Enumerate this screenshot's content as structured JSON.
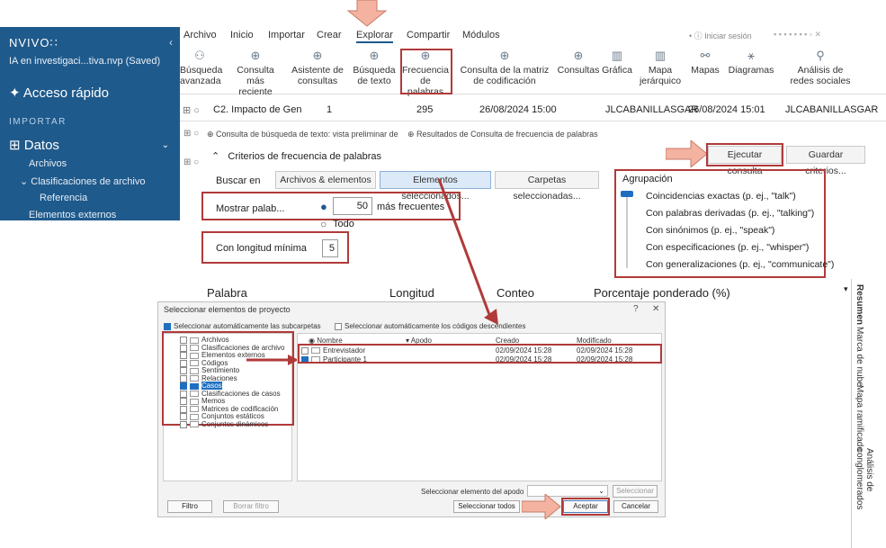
{
  "sidebar": {
    "brand": "NVIVO∷",
    "project": "IA en investigaci...tiva.nvp (Saved)",
    "quick_access": "Acceso rápido",
    "section": "IMPORTAR",
    "datos": "Datos",
    "items": [
      "Archivos",
      "Clasificaciones de archivo",
      "Referencia",
      "Elementos externos"
    ]
  },
  "menu": {
    "tabs": [
      "Archivo",
      "Inicio",
      "Importar",
      "Crear",
      "Explorar",
      "Compartir",
      "Módulos"
    ],
    "active": "Explorar",
    "right": "• ⓘ Iniciar sesión"
  },
  "ribbon": {
    "buttons": [
      {
        "l1": "Búsqueda",
        "l2": "avanzada",
        "icon": "binoculars-icon"
      },
      {
        "l1": "Consulta",
        "l2": "más reciente",
        "icon": "magnifier-icon"
      },
      {
        "l1": "Asistente de",
        "l2": "consultas",
        "icon": "magnifier-icon"
      },
      {
        "l1": "Búsqueda",
        "l2": "de texto",
        "icon": "magnifier-icon"
      },
      {
        "l1": "Frecuencia",
        "l2": "de palabras",
        "icon": "magnifier-icon"
      },
      {
        "l1": "Consulta de la matriz",
        "l2": "de codificación",
        "icon": "magnifier-icon"
      },
      {
        "l1": "Consultas",
        "l2": "",
        "icon": "magnifier-icon"
      },
      {
        "l1": "Gráfica",
        "l2": "",
        "icon": "chart-icon"
      },
      {
        "l1": "Mapa",
        "l2": "jerárquico",
        "icon": "chart-icon"
      },
      {
        "l1": "Mapas",
        "l2": "",
        "icon": "map-icon"
      },
      {
        "l1": "Diagramas",
        "l2": "",
        "icon": "diagram-icon"
      },
      {
        "l1": "Análisis de",
        "l2": "redes sociales",
        "icon": "network-icon"
      }
    ]
  },
  "row": {
    "name": "C2. Impacto de Gen",
    "count": "1",
    "refs": "295",
    "created": "26/08/2024 15:00",
    "by": "JLCABANILLASGAR",
    "modified": "26/08/2024 15:01",
    "by2": "JLCABANILLASGAR"
  },
  "panel": {
    "tab1": "Consulta de búsqueda de texto: vista preliminar de",
    "tab2": "Resultados de Consulta de frecuencia de palabras",
    "criteria_title": "Criterios de frecuencia de palabras",
    "run": "Ejecutar consulta",
    "save": "Guardar criterios...",
    "search_in": "Buscar en",
    "opt1": "Archivos & elementos",
    "opt2": "Elementos seleccionados...",
    "opt3": "Carpetas seleccionadas...",
    "show_words": "Mostrar palab...",
    "top_n": "50",
    "most_freq": "más frecuentes",
    "all": "Todo",
    "min_len_label": "Con longitud mínima",
    "min_len": "5",
    "grouping": "Agrupación",
    "g1": "Coincidencias exactas (p. ej., \"talk\")",
    "g2": "Con palabras derivadas (p. ej., \"talking\")",
    "g3": "Con sinónimos (p. ej., \"speak\")",
    "g4": "Con especificaciones (p. ej., \"whisper\")",
    "g5": "Con generalizaciones (p. ej., \"communicate\")",
    "col_word": "Palabra",
    "col_len": "Longitud",
    "col_count": "Conteo",
    "col_pct": "Porcentaje ponderado (%)",
    "vtabs": [
      "Resumen",
      "Marca de nube",
      "Mapa ramificado",
      "Análisis de conglomerados"
    ]
  },
  "dialog": {
    "title": "Seleccionar elementos de proyecto",
    "help": "?",
    "close": "✕",
    "auto_sub": "Seleccionar automáticamente las subcarpetas",
    "auto_desc": "Seleccionar automáticamente los códigos descendientes",
    "tree": [
      "Archivos",
      "Clasificaciones de archivo",
      "Elementos externos",
      "Códigos",
      "Sentimiento",
      "Relaciones",
      "Casos",
      "Clasificaciones de casos",
      "Memos",
      "Matrices de codificación",
      "Conjuntos estáticos",
      "Conjuntos dinámicos"
    ],
    "col_name": "Nombre",
    "col_apodo": "Apodo",
    "col_created": "Creado",
    "col_modified": "Modificado",
    "rows": [
      {
        "name": "Entrevistador",
        "created": "02/09/2024 15:28",
        "modified": "02/09/2024 15:28"
      },
      {
        "name": "Participante 1",
        "created": "02/09/2024 15:28",
        "modified": "02/09/2024 15:28"
      }
    ],
    "select_apodo": "Seleccionar elemento del apodo",
    "select_btn": "Seleccionar",
    "filter": "Filtro",
    "clear_filter": "Borrar filtro",
    "select_all": "Seleccionar todos",
    "accept": "Aceptar",
    "cancel": "Cancelar"
  },
  "colors": {
    "accent": "#1f5a8c",
    "annotation": "#b03a3a",
    "arrow": "#f0a890"
  }
}
